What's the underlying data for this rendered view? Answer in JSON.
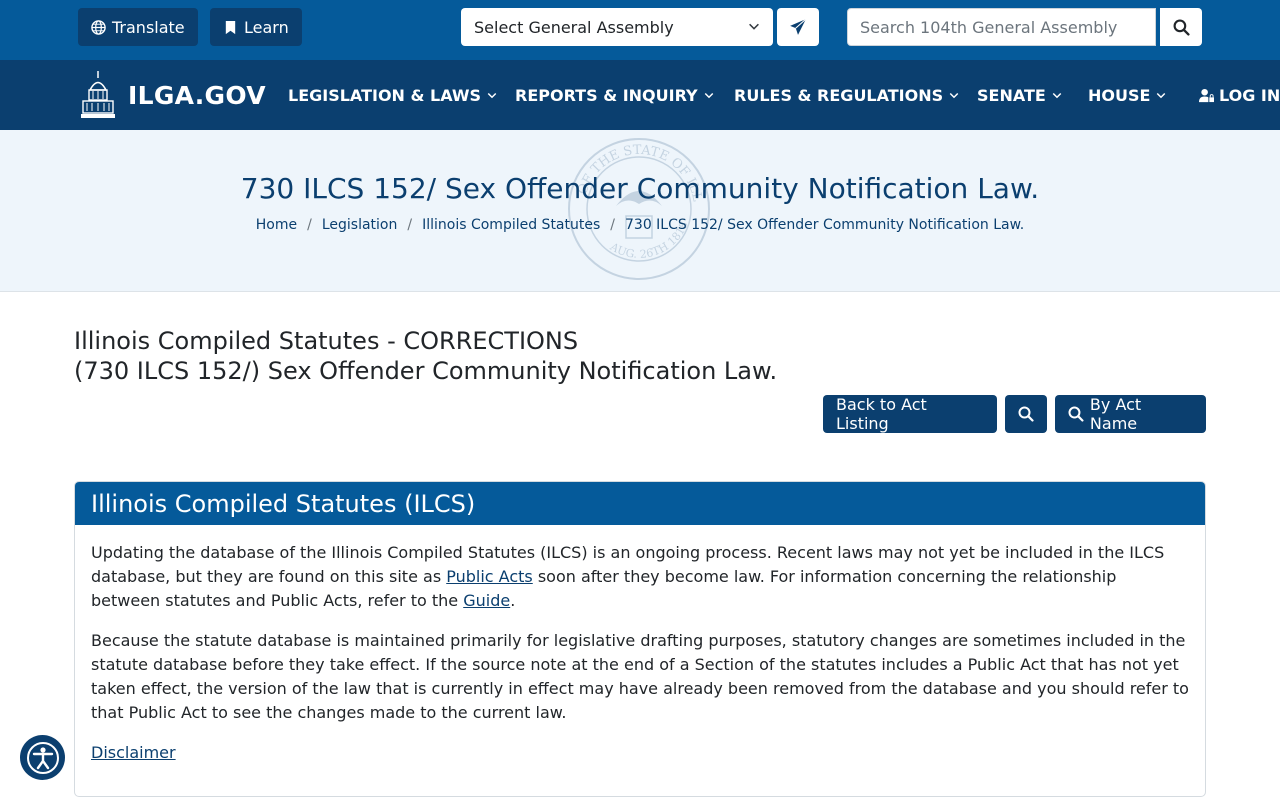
{
  "topbar": {
    "translate_label": "Translate",
    "learn_label": "Learn",
    "assembly_select": "Select General Assembly",
    "search_placeholder": "Search 104th General Assembly"
  },
  "brand": {
    "name": "ILGA.GOV"
  },
  "nav": {
    "items": [
      {
        "label": "LEGISLATION & LAWS"
      },
      {
        "label": "REPORTS & INQUIRY"
      },
      {
        "label": "RULES & REGULATIONS"
      },
      {
        "label": "SENATE"
      },
      {
        "label": "HOUSE"
      }
    ],
    "login_label": "LOG IN"
  },
  "hero": {
    "title": "730 ILCS 152/ Sex Offender Community Notification Law.",
    "breadcrumbs": [
      "Home",
      "Legislation",
      "Illinois Compiled Statutes",
      "730 ILCS 152/ Sex Offender Community Notification Law."
    ],
    "seal_text_top": "OF THE STATE OF ILL",
    "seal_text_bottom": "AUG. 26TH 1818"
  },
  "main": {
    "heading_line1": "Illinois Compiled Statutes - CORRECTIONS",
    "heading_line2": "(730 ILCS 152/) Sex Offender Community Notification Law.",
    "back_button": "Back to Act Listing",
    "by_act_name_button": "By Act Name"
  },
  "card": {
    "title": "Illinois Compiled Statutes (ILCS)",
    "p1_before": "Updating the database of the Illinois Compiled Statutes (ILCS) is an ongoing process. Recent laws may not yet be included in the ILCS database, but they are found on this site as ",
    "p1_link1": "Public Acts",
    "p1_middle": " soon after they become law. For information concerning the relationship between statutes and Public Acts, refer to the ",
    "p1_link2": "Guide",
    "p1_after": ".",
    "p2": "Because the statute database is maintained primarily for legislative drafting purposes, statutory changes are sometimes included in the statute database before they take effect. If the source note at the end of a Section of the statutes includes a Public Act that has not yet taken effect, the version of the law that is currently in effect may have already been removed from the database and you should refer to that Public Act to see the changes made to the current law.",
    "disclaimer_link": "Disclaimer"
  },
  "colors": {
    "topbar": "#055a9a",
    "navbar": "#0b3f6f",
    "hero_bg": "#eef5fb",
    "card_header": "#055a9a"
  }
}
